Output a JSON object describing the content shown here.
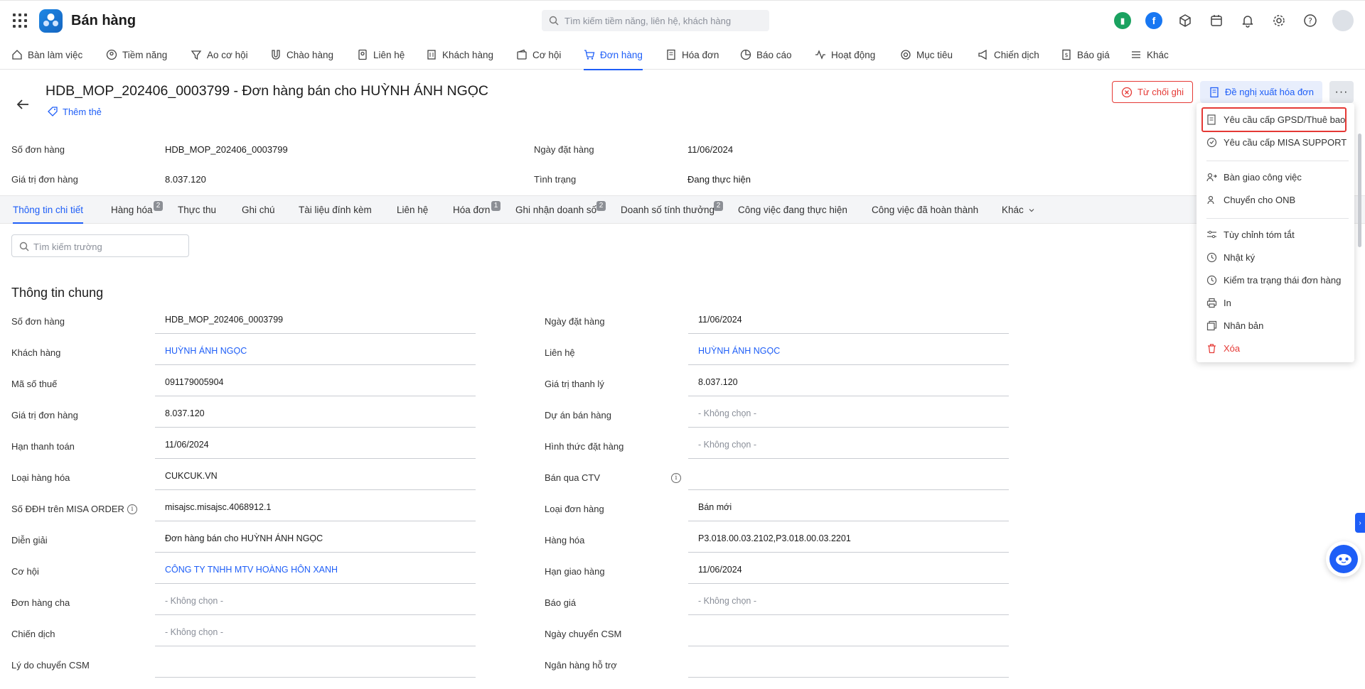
{
  "header": {
    "app_title": "Bán hàng",
    "search_placeholder": "Tìm kiếm tiềm năng, liên hệ, khách hàng"
  },
  "nav": [
    {
      "label": "Bàn làm việc",
      "icon": "home-icon"
    },
    {
      "label": "Tiềm năng",
      "icon": "user-circle-icon"
    },
    {
      "label": "Ao cơ hội",
      "icon": "funnel-icon"
    },
    {
      "label": "Chào hàng",
      "icon": "magnet-icon"
    },
    {
      "label": "Liên hệ",
      "icon": "contact-card-icon"
    },
    {
      "label": "Khách hàng",
      "icon": "building-icon"
    },
    {
      "label": "Cơ hội",
      "icon": "wallet-icon"
    },
    {
      "label": "Đơn hàng",
      "icon": "cart-icon",
      "active": true
    },
    {
      "label": "Hóa đơn",
      "icon": "invoice-icon"
    },
    {
      "label": "Báo cáo",
      "icon": "pie-chart-icon"
    },
    {
      "label": "Hoạt động",
      "icon": "activity-icon"
    },
    {
      "label": "Mục tiêu",
      "icon": "target-icon"
    },
    {
      "label": "Chiến dịch",
      "icon": "megaphone-icon"
    },
    {
      "label": "Báo giá",
      "icon": "quote-icon"
    },
    {
      "label": "Khác",
      "icon": "menu-icon"
    }
  ],
  "record": {
    "title": "HDB_MOP_202406_0003799 - Đơn hàng bán cho HUỲNH ÁNH NGỌC",
    "add_tag": "Thêm thẻ",
    "reject_button": "Từ chối ghi",
    "invoice_button": "Đề nghị xuất hóa đơn",
    "more_button": "···"
  },
  "summary": {
    "order_no_label": "Số đơn hàng",
    "order_no": "HDB_MOP_202406_0003799",
    "order_date_label": "Ngày đặt hàng",
    "order_date": "11/06/2024",
    "order_value_label": "Giá trị đơn hàng",
    "order_value": "8.037.120",
    "status_label": "Tình trạng",
    "status": "Đang thực hiện"
  },
  "tabs": [
    {
      "label": "Thông tin chi tiết",
      "active": true
    },
    {
      "label": "Hàng hóa",
      "badge": "2"
    },
    {
      "label": "Thực thu"
    },
    {
      "label": "Ghi chú"
    },
    {
      "label": "Tài liệu đính kèm"
    },
    {
      "label": "Liên hệ"
    },
    {
      "label": "Hóa đơn",
      "badge": "1"
    },
    {
      "label": "Ghi nhận doanh số",
      "badge": "2"
    },
    {
      "label": "Doanh số tính thưởng",
      "badge": "2"
    },
    {
      "label": "Công việc đang thực hiện"
    },
    {
      "label": "Công việc đã hoàn thành"
    },
    {
      "label": "Khác"
    }
  ],
  "field_search_placeholder": "Tìm kiếm trường",
  "section_title": "Thông tin chung",
  "left_fields": [
    {
      "label": "Số đơn hàng",
      "value": "HDB_MOP_202406_0003799"
    },
    {
      "label": "Khách hàng",
      "value": "HUỲNH ÁNH NGỌC",
      "link": true
    },
    {
      "label": "Mã số thuế",
      "value": "091179005904"
    },
    {
      "label": "Giá trị đơn hàng",
      "value": "8.037.120"
    },
    {
      "label": "Hạn thanh toán",
      "value": "11/06/2024"
    },
    {
      "label": "Loại hàng hóa",
      "value": "CUKCUK.VN"
    },
    {
      "label": "Số ĐĐH trên MISA ORDER",
      "value": "misajsc.misajsc.4068912.1",
      "info": true
    },
    {
      "label": "Diễn giải",
      "value": "Đơn hàng bán cho HUỲNH ÁNH NGỌC"
    },
    {
      "label": "Cơ hội",
      "value": "CÔNG TY TNHH MTV HOÀNG HÔN XANH",
      "link": true
    },
    {
      "label": "Đơn hàng cha",
      "value": "- Không chọn -",
      "muted": true
    },
    {
      "label": "Chiến dịch",
      "value": "- Không chọn -",
      "muted": true
    },
    {
      "label": "Lý do chuyển CSM",
      "value": ""
    }
  ],
  "right_fields": [
    {
      "label": "Ngày đặt hàng",
      "value": "11/06/2024"
    },
    {
      "label": "Liên hệ",
      "value": "HUỲNH ÁNH NGỌC",
      "link": true
    },
    {
      "label": "Giá trị thanh lý",
      "value": "8.037.120"
    },
    {
      "label": "Dự án bán hàng",
      "value": "- Không chọn -",
      "muted": true
    },
    {
      "label": "Hình thức đặt hàng",
      "value": "- Không chọn -",
      "muted": true
    },
    {
      "label": "Bán qua CTV",
      "value": "",
      "info": true
    },
    {
      "label": "Loại đơn hàng",
      "value": "Bán mới"
    },
    {
      "label": "Hàng hóa",
      "value": "P3.018.00.03.2102,P3.018.00.03.2201"
    },
    {
      "label": "Hạn giao hàng",
      "value": "11/06/2024"
    },
    {
      "label": "Báo giá",
      "value": "- Không chọn -",
      "muted": true
    },
    {
      "label": "Ngày chuyển CSM",
      "value": ""
    },
    {
      "label": "Ngân hàng hỗ trợ",
      "value": ""
    }
  ],
  "dropdown": [
    {
      "label": "Yêu cầu cấp GPSD/Thuê bao",
      "icon": "license-request-icon",
      "highlight": true
    },
    {
      "label": "Yêu cầu cấp MISA SUPPORT",
      "icon": "support-icon"
    },
    {
      "label": "Bàn giao công việc",
      "icon": "handover-icon"
    },
    {
      "label": "Chuyển cho ONB",
      "icon": "transfer-user-icon"
    },
    {
      "label": "Tùy chỉnh tóm tắt",
      "icon": "sliders-icon"
    },
    {
      "label": "Nhật ký",
      "icon": "history-icon"
    },
    {
      "label": "Kiểm tra trạng thái đơn hàng",
      "icon": "status-check-icon"
    },
    {
      "label": "In",
      "icon": "printer-icon"
    },
    {
      "label": "Nhân bản",
      "icon": "duplicate-icon"
    },
    {
      "label": "Xóa",
      "icon": "trash-icon",
      "danger": true
    }
  ],
  "colors": {
    "accent": "#1e5ef7",
    "danger": "#e53935"
  }
}
